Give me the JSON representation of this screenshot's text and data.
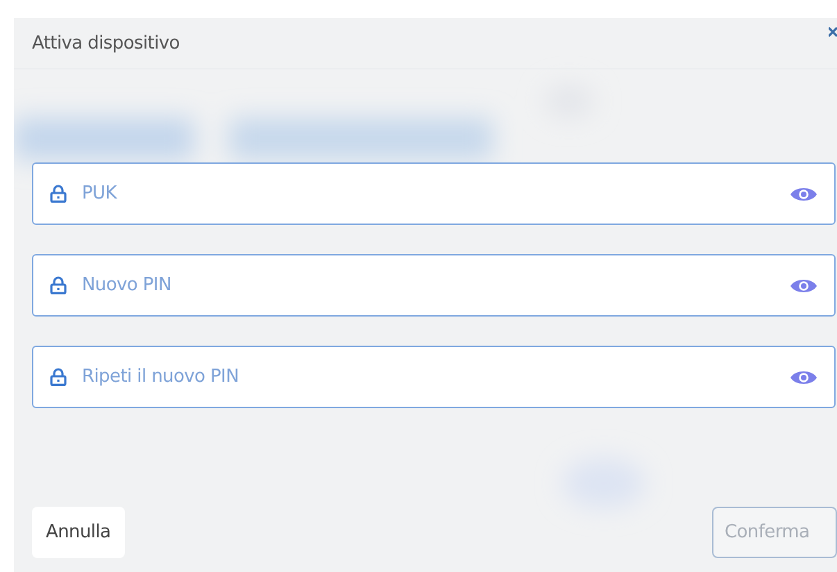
{
  "dialog": {
    "title": "Attiva dispositivo"
  },
  "fields": [
    {
      "placeholder": "PUK"
    },
    {
      "placeholder": "Nuovo PIN"
    },
    {
      "placeholder": "Ripeti il nuovo PIN"
    }
  ],
  "buttons": [
    {
      "label": "Annulla",
      "disabled": false
    },
    {
      "label": "Conferma",
      "disabled": true
    }
  ]
}
